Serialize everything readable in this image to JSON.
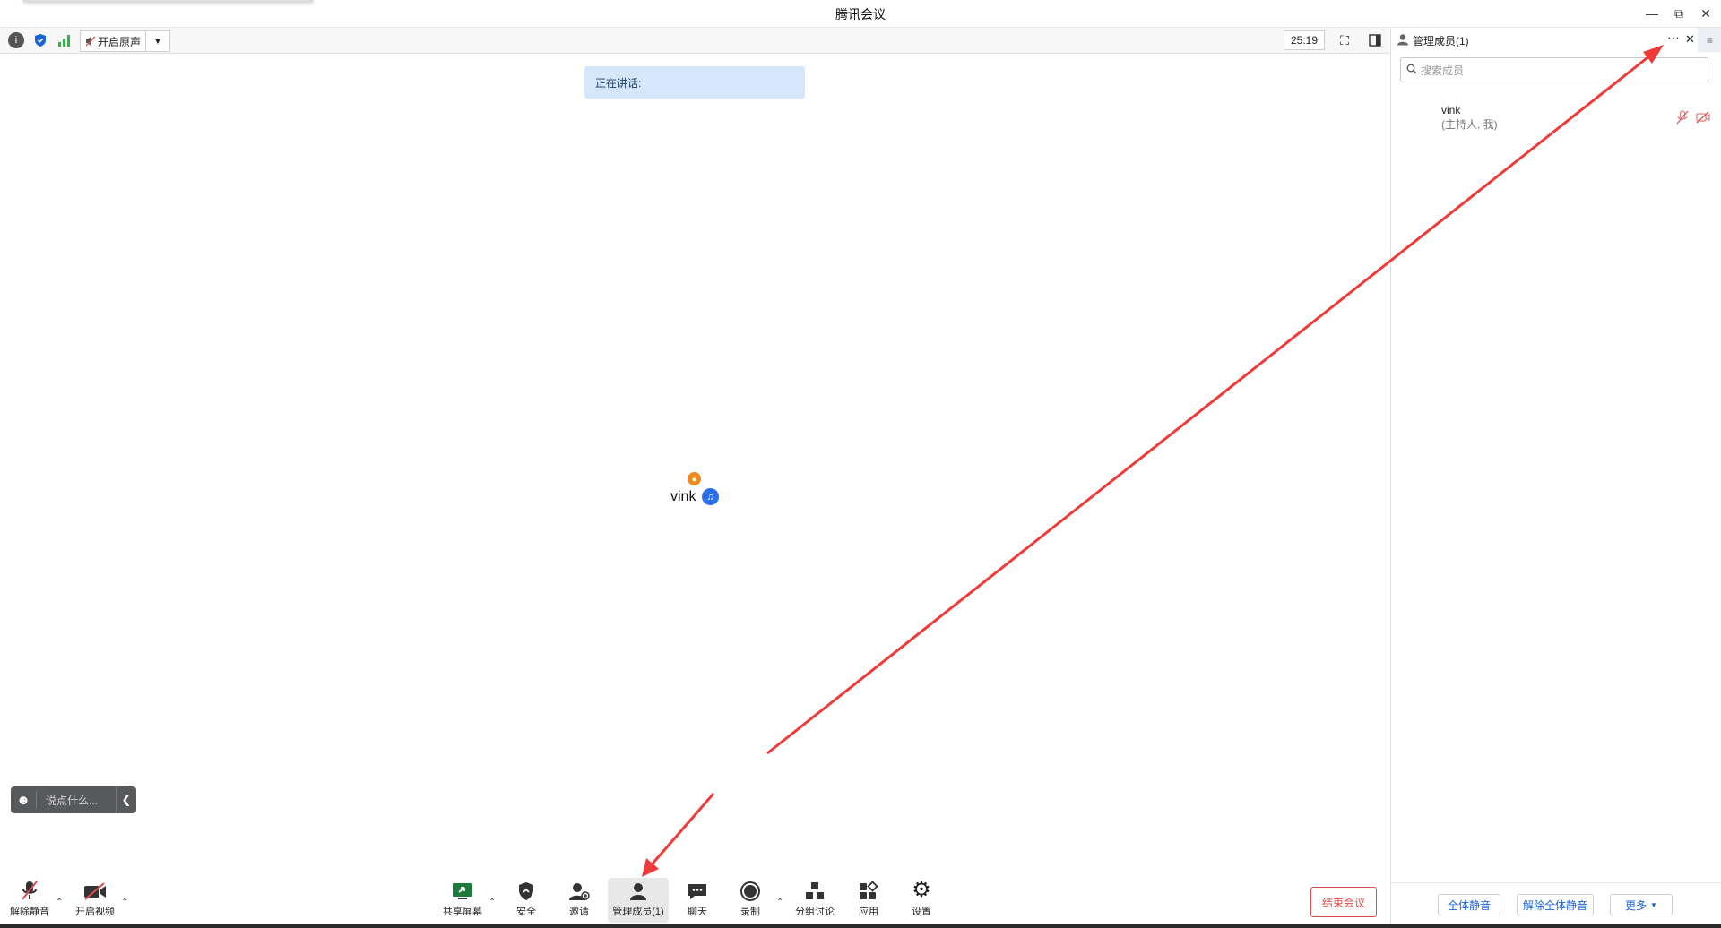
{
  "window": {
    "title": "腾讯会议"
  },
  "toolbar": {
    "original_sound_label": "开启原声",
    "timer": "25:19"
  },
  "speaking": {
    "label": "正在讲话:"
  },
  "stage": {
    "user_name": "vink"
  },
  "chat": {
    "placeholder": "说点什么..."
  },
  "bottom_bar": {
    "unmute": "解除静音",
    "start_video": "开启视频",
    "share_screen": "共享屏幕",
    "security": "安全",
    "invite": "邀请",
    "manage_members": "管理成员(1)",
    "chat": "聊天",
    "record": "录制",
    "breakout": "分组讨论",
    "apps": "应用",
    "settings": "设置",
    "end_meeting": "结束会议"
  },
  "panel": {
    "title": "管理成员(1)",
    "search_placeholder": "搜索成员",
    "members": [
      {
        "name": "vink",
        "role": "(主持人, 我)"
      }
    ],
    "mute_all": "全体静音",
    "unmute_all": "解除全体静音",
    "more": "更多"
  },
  "colors": {
    "accent": "#1a63d8",
    "danger": "#e24b4b",
    "annotation_arrow": "#f03a3a"
  }
}
